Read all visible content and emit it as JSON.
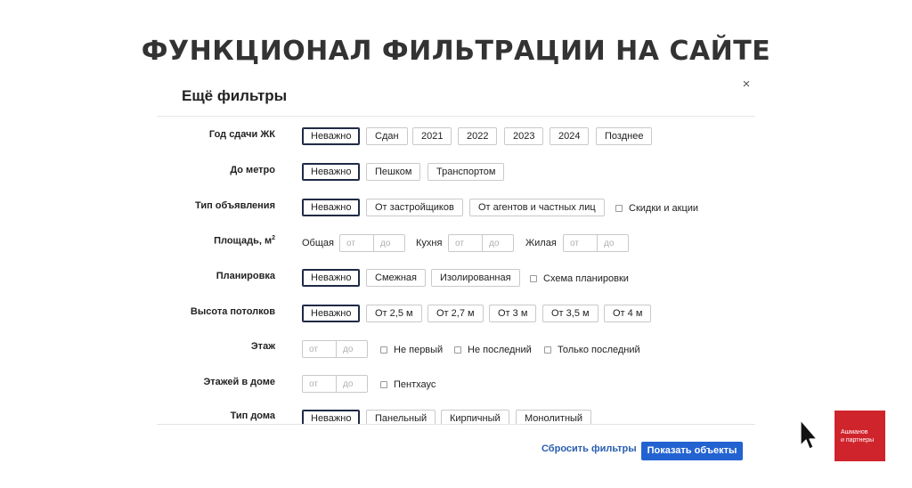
{
  "slide": {
    "title": "ФУНКЦИОНАЛ ФИЛЬТРАЦИИ НА САЙТЕ"
  },
  "modal": {
    "title": "Ещё фильтры",
    "close": "×"
  },
  "rows": {
    "year": {
      "label": "Год сдачи ЖК",
      "chips": [
        "Неважно",
        "Сдан",
        "2021",
        "2022",
        "2023",
        "2024",
        "Позднее"
      ]
    },
    "metro": {
      "label": "До метро",
      "chips": [
        "Неважно",
        "Пешком",
        "Транспортом"
      ]
    },
    "listing": {
      "label": "Тип объявления",
      "chips": [
        "Неважно",
        "От застройщиков",
        "От агентов и частных лиц"
      ],
      "checkbox": "Скидки и акции"
    },
    "area": {
      "label": "Площадь, м",
      "sup": "2",
      "groups": [
        {
          "label": "Общая",
          "from": "от",
          "to": "до"
        },
        {
          "label": "Кухня",
          "from": "от",
          "to": "до"
        },
        {
          "label": "Жилая",
          "from": "от",
          "to": "до"
        }
      ]
    },
    "layout": {
      "label": "Планировка",
      "chips": [
        "Неважно",
        "Смежная",
        "Изолированная"
      ],
      "checkbox": "Схема планировки"
    },
    "ceiling": {
      "label": "Высота потолков",
      "chips": [
        "Неважно",
        "От 2,5 м",
        "От 2,7 м",
        "От 3 м",
        "От 3,5 м",
        "От 4 м"
      ]
    },
    "floor": {
      "label": "Этаж",
      "from": "от",
      "to": "до",
      "checkboxes": [
        "Не первый",
        "Не последний",
        "Только последний"
      ]
    },
    "floors_total": {
      "label": "Этажей в доме",
      "from": "от",
      "to": "до",
      "checkbox": "Пентхаус"
    },
    "house_type": {
      "label": "Тип дома",
      "chips": [
        "Неважно",
        "Панельный",
        "Кирпичный",
        "Монолитный"
      ]
    }
  },
  "footer": {
    "reset": "Сбросить фильтры",
    "show": "Показать объекты"
  },
  "logo": {
    "line1": "Ашманов",
    "line2": "и партнеры"
  },
  "colors": {
    "accent": "#2363d1",
    "link": "#2a5db0",
    "active_border": "#1f2a44",
    "logo_bg": "#d0242c"
  }
}
